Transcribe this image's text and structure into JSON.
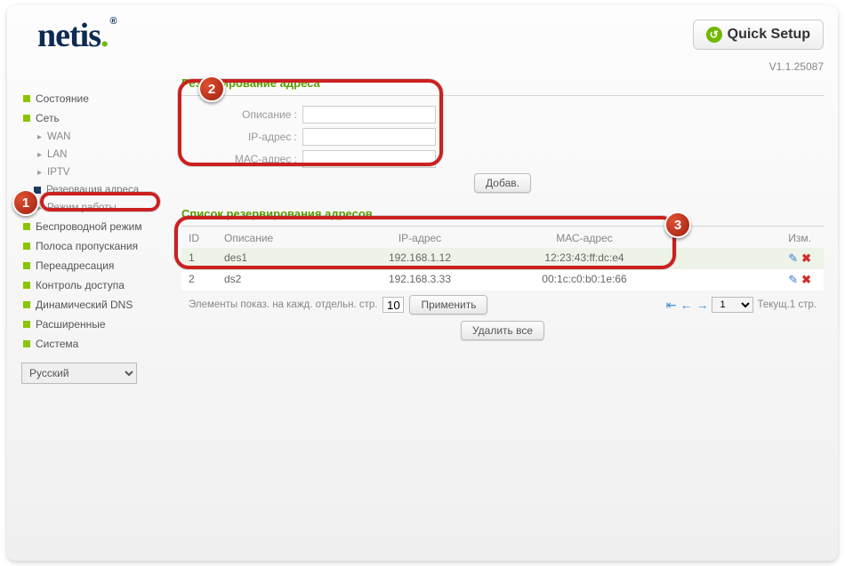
{
  "brand": "netis",
  "quick_setup": "Quick Setup",
  "version": "V1.1.25087",
  "sidebar": {
    "items": [
      {
        "label": "Состояние"
      },
      {
        "label": "Сеть"
      },
      {
        "label": "Беспроводной режим"
      },
      {
        "label": "Полоса пропускания"
      },
      {
        "label": "Переадресация"
      },
      {
        "label": "Контроль доступа"
      },
      {
        "label": "Динамический DNS"
      },
      {
        "label": "Расширенные"
      },
      {
        "label": "Система"
      }
    ],
    "net_sub": {
      "wan": "WAN",
      "lan": "LAN",
      "iptv": "IPTV",
      "reserve": "Резервация адреса",
      "mode": "Режим работы"
    },
    "language": "Русский"
  },
  "main": {
    "section1_title": "Резервирование адреса",
    "labels": {
      "desc": "Описание :",
      "ip": "IP-адрес :",
      "mac": "МАС-адрес :"
    },
    "add_btn": "Добав.",
    "section2_title": "Список резервирования адресов",
    "columns": {
      "id": "ID",
      "desc": "Описание",
      "ip": "IP-адрес",
      "mac": "МАС-адрес",
      "act": "Изм."
    },
    "rows": [
      {
        "id": "1",
        "desc": "des1",
        "ip": "192.168.1.12",
        "mac": "12:23:43:ff:dc:e4"
      },
      {
        "id": "2",
        "desc": "ds2",
        "ip": "192.168.3.33",
        "mac": "00:1c:c0:b0:1e:66"
      }
    ],
    "pager": {
      "text": "Элементы показ. на кажд. отдельн. стр.",
      "per_page": "10",
      "apply": "Применить",
      "page_sel": "1",
      "status": "Текущ.1 стр."
    },
    "delete_all": "Удалить все"
  }
}
